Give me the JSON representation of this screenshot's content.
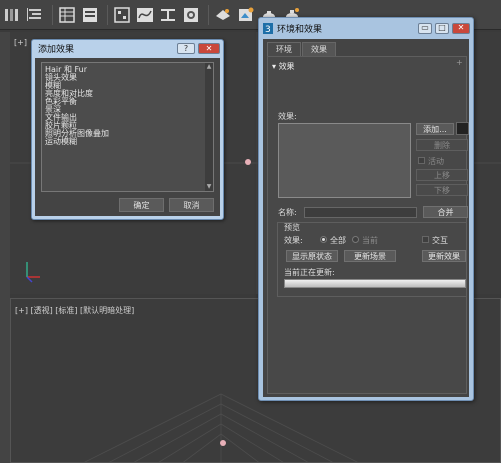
{
  "toolbar": {
    "icons": [
      "select-region-icon",
      "align-icon",
      "table-icon",
      "layers-icon",
      "graph-editor-icon",
      "curve-editor-icon",
      "schematic-icon",
      "material-editor-icon",
      "render-setup-icon",
      "render-frame-icon",
      "render-teapot-icon",
      "render-active-icon"
    ]
  },
  "viewport_top": {
    "label": "[+] [透视] [标准] [默认明暗处理]",
    "corner": "[+]"
  },
  "viewport_bottom": {
    "label": "[+] [透视] [标准] [默认明暗处理]"
  },
  "add_effect_dialog": {
    "title": "添加效果",
    "help_label": "?",
    "close_label": "✕",
    "items": [
      "Hair 和 Fur",
      "镜头效果",
      "模糊",
      "亮度和对比度",
      "色彩平衡",
      "景深",
      "文件输出",
      "胶片颗粒",
      "照明分析图像叠加",
      "运动模糊"
    ],
    "ok_label": "确定",
    "cancel_label": "取消"
  },
  "env_window": {
    "title": "环境和效果",
    "tabs": [
      "环境",
      "效果"
    ],
    "rollout_title": "效果",
    "effects_label": "效果:",
    "add_button": "添加...",
    "delete_button": "删除",
    "active_label": "活动",
    "move_up_button": "上移",
    "move_down_button": "下移",
    "name_label": "名称:",
    "merge_button": "合并",
    "preview_label": "预览",
    "effects_scope_label": "效果:",
    "all_label": "全部",
    "current_label": "当前",
    "interactive_label": "交互",
    "show_original_button": "显示原状态",
    "update_scene_button": "更新场景",
    "update_effect_button": "更新效果",
    "status_text": "当前正在更新:",
    "progress": 1.0
  }
}
